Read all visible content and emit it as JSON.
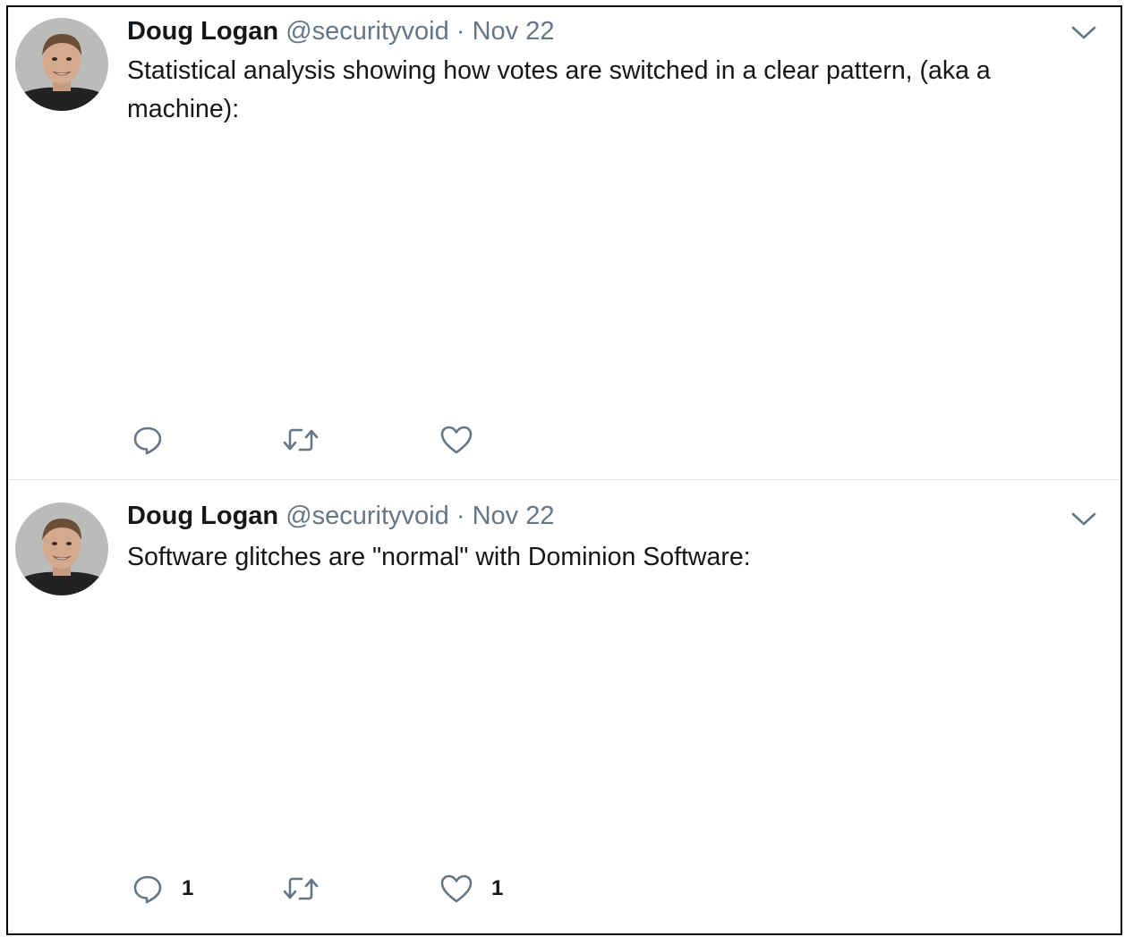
{
  "tweets": [
    {
      "author_name": "Doug Logan",
      "author_handle": "@securityvoid",
      "separator": "·",
      "date": "Nov 22",
      "text": "Statistical analysis showing how votes are switched in a clear pattern, (aka a machine):",
      "reply_count": "",
      "retweet_count": "",
      "like_count": ""
    },
    {
      "author_name": "Doug Logan",
      "author_handle": "@securityvoid",
      "separator": "·",
      "date": "Nov 22",
      "text": "Software glitches are \"normal\" with Dominion Software:",
      "reply_count": "1",
      "retweet_count": "",
      "like_count": "1"
    }
  ],
  "icons": {
    "reply": "reply-icon",
    "retweet": "retweet-icon",
    "like": "heart-icon",
    "more": "chevron-down-icon"
  },
  "colors": {
    "icon": "#657786",
    "text": "#14171a",
    "muted": "#657786",
    "divider": "#e1e8ed"
  }
}
